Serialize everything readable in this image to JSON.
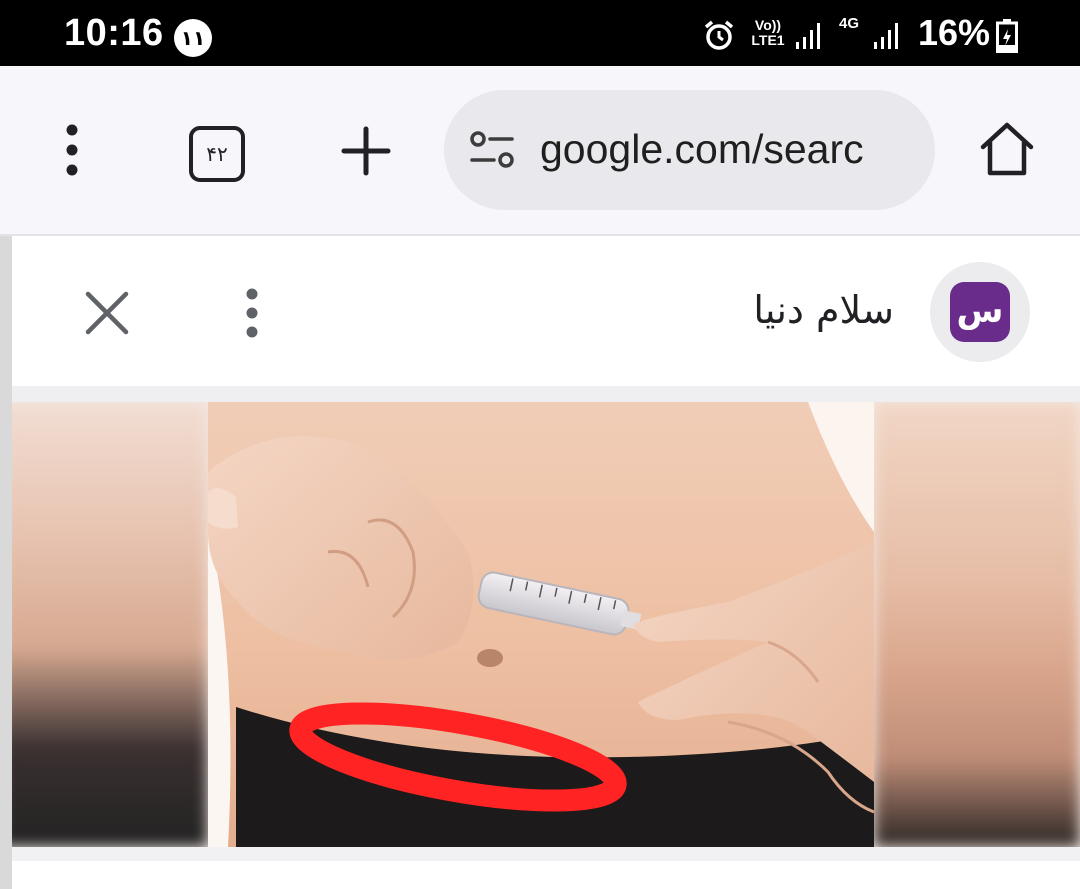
{
  "status_bar": {
    "time": "10:16",
    "notification_count": "١١",
    "volte_label": "Vo)) LTE1",
    "network_type": "4G",
    "battery_percent": "16%"
  },
  "browser": {
    "tab_count": "۴۲",
    "url": "google.com/searc"
  },
  "sheet": {
    "site_name": "سلام دنیا",
    "avatar_letter": "س"
  },
  "icons": [
    "alarm-icon",
    "signal-icon",
    "battery-charging-icon",
    "menu-dots-icon",
    "tabs-icon",
    "plus-icon",
    "tune-icon",
    "home-icon",
    "close-icon",
    "more-vert-icon"
  ],
  "colors": {
    "annotation_red": "#ff2323",
    "avatar_purple": "#6a2c8a"
  }
}
